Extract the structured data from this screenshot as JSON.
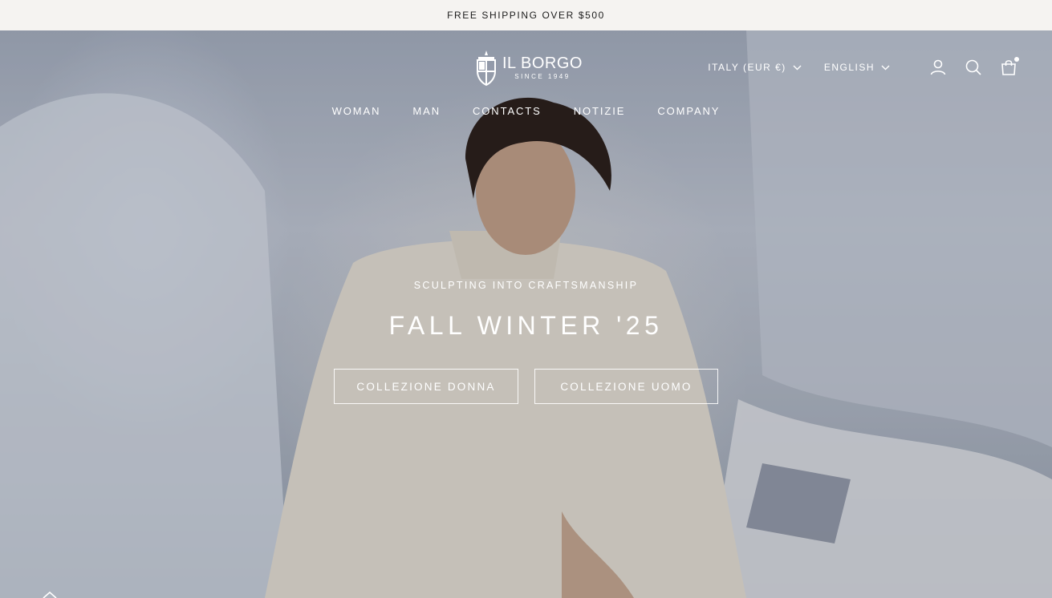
{
  "announcement": {
    "text": "FREE SHIPPING OVER $500"
  },
  "brand": {
    "name": "IL BORGO",
    "since": "SINCE 1949"
  },
  "header": {
    "country_selector": "ITALY (EUR €)",
    "language_selector": "ENGLISH",
    "icons": [
      "account-icon",
      "search-icon",
      "cart-icon",
      "chevron-down-icon"
    ]
  },
  "nav": {
    "items": [
      {
        "label": "WOMAN"
      },
      {
        "label": "MAN"
      },
      {
        "label": "CONTACTS"
      },
      {
        "label": "NOTIZIE"
      },
      {
        "label": "COMPANY"
      }
    ]
  },
  "hero": {
    "eyebrow": "SCULPTING INTO CRAFTSMANSHIP",
    "headline": "FALL WINTER '25",
    "buttons": [
      {
        "label": "COLLEZIONE DONNA"
      },
      {
        "label": "COLLEZIONE UOMO"
      }
    ]
  },
  "colors": {
    "announcement_bg": "#f5f3f1",
    "announcement_text": "#1b1b1b",
    "overlay_text": "#ffffff"
  }
}
